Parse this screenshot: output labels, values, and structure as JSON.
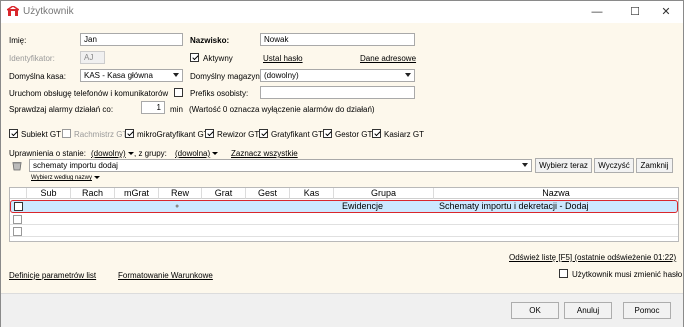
{
  "window": {
    "title": "Użytkownik",
    "minimize": "—",
    "maximize": "☐",
    "close": "✕"
  },
  "user": {
    "first_name_label": "Imię:",
    "first_name": "Jan",
    "last_name_label": "Nazwisko:",
    "last_name": "Nowak",
    "id_label": "Identyfikator:",
    "id_value": "AJ",
    "active_label": "Aktywny",
    "password_link": "Ustal hasło",
    "address_link": "Dane adresowe",
    "cash_label": "Domyślna kasa:",
    "cash_value": "KAS - Kasa główna",
    "warehouse_label": "Domyślny magazyn:",
    "warehouse_value": "(dowolny)",
    "phone_label": "Uruchom obsługę telefonów i komunikatorów",
    "prefix_label": "Prefiks osobisty:",
    "prefix_value": "",
    "alarm_label": "Sprawdzaj alarmy działań co:",
    "alarm_value": "1",
    "alarm_unit": "min",
    "alarm_note": "(Wartość 0 oznacza wyłączenie alarmów do działań)"
  },
  "modules": [
    {
      "label": "Subiekt GT",
      "checked": true,
      "disabled": false
    },
    {
      "label": "Rachmistrz GT",
      "checked": false,
      "disabled": true
    },
    {
      "label": "mikroGratyfikant GT",
      "checked": true,
      "disabled": false
    },
    {
      "label": "Rewizor GT",
      "checked": true,
      "disabled": false
    },
    {
      "label": "Gratyfikant GT",
      "checked": true,
      "disabled": false
    },
    {
      "label": "Gestor GT",
      "checked": true,
      "disabled": false
    },
    {
      "label": "Kasiarz GT",
      "checked": true,
      "disabled": false
    }
  ],
  "permissions": {
    "state_label": "Uprawnienia o stanie:",
    "state_value": "(dowolny)",
    "group_label": ", z grupy:",
    "group_value": "(dowolna)",
    "select_all": "Zaznacz wszystkie",
    "search_value": "schematy importu dodaj",
    "search_button": "Wybierz teraz",
    "clear_button": "Wyczyść",
    "close_button": "Zamknij",
    "sort_label": "Wybierz według nazwy"
  },
  "table": {
    "columns": [
      "Sub",
      "Rach",
      "mGrat",
      "Rew",
      "Grat",
      "Gest",
      "Kas",
      "Grupa",
      "Nazwa"
    ],
    "rows": [
      {
        "group": "Ewidencje",
        "name": "Schematy importu i dekretacji - Dodaj",
        "rew_dot": "●"
      }
    ]
  },
  "refresh_link": "Odśwież listę [F5] (ostatnie odświeżenie 01:22)",
  "footer": {
    "params_link": "Definicje parametrów list",
    "format_link": "Formatowanie Warunkowe",
    "must_change_label": "Użytkownik musi zmienić hasło",
    "ok": "OK",
    "cancel": "Anuluj",
    "help": "Pomoc"
  },
  "colors": {
    "selection": "#cce8ff",
    "highlight_border": "#d9262c",
    "background": "#fdf8ec"
  }
}
